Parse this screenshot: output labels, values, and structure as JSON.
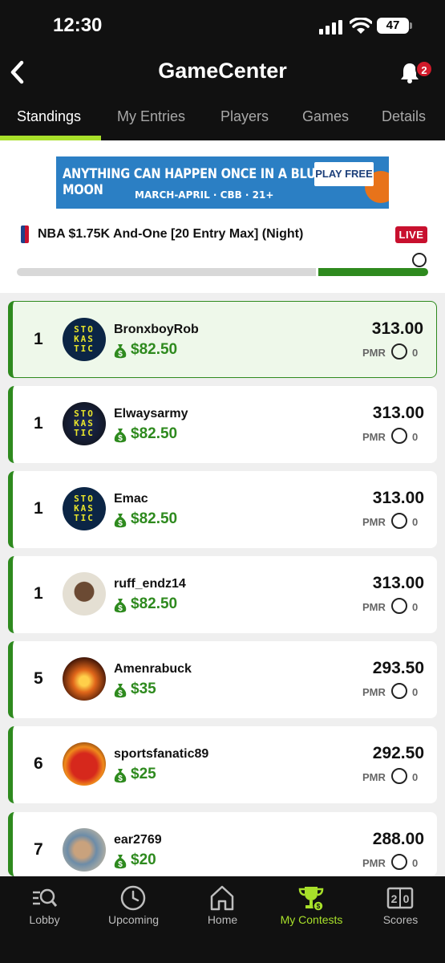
{
  "status_bar": {
    "time": "12:30",
    "battery": "47"
  },
  "header": {
    "title": "GameCenter",
    "notification_count": "2"
  },
  "tabs": [
    {
      "label": "Standings",
      "active": true
    },
    {
      "label": "My Entries",
      "active": false
    },
    {
      "label": "Players",
      "active": false
    },
    {
      "label": "Games",
      "active": false
    },
    {
      "label": "Details",
      "active": false
    }
  ],
  "ad": {
    "headline": "ANYTHING CAN HAPPEN ONCE IN A BLUE MOON",
    "subline": "MARCH-APRIL · CBB · 21+",
    "cta": "PLAY FREE"
  },
  "contest": {
    "name": "NBA $1.75K And-One [20 Entry Max] (Night)",
    "status": "LIVE"
  },
  "standings": [
    {
      "rank": "1",
      "username": "BronxboyRob",
      "winnings": "$82.50",
      "score": "313.00",
      "pmr_label": "PMR",
      "pmr": "0",
      "avatar": "stokastic"
    },
    {
      "rank": "1",
      "username": "Elwaysarmy",
      "winnings": "$82.50",
      "score": "313.00",
      "pmr_label": "PMR",
      "pmr": "0",
      "avatar": "stokastic"
    },
    {
      "rank": "1",
      "username": "Emac",
      "winnings": "$82.50",
      "score": "313.00",
      "pmr_label": "PMR",
      "pmr": "0",
      "avatar": "stokastic"
    },
    {
      "rank": "1",
      "username": "ruff_endz14",
      "winnings": "$82.50",
      "score": "313.00",
      "pmr_label": "PMR",
      "pmr": "0",
      "avatar": "photo"
    },
    {
      "rank": "5",
      "username": "Amenrabuck",
      "winnings": "$35",
      "score": "293.50",
      "pmr_label": "PMR",
      "pmr": "0",
      "avatar": "phoenix"
    },
    {
      "rank": "6",
      "username": "sportsfanatic89",
      "winnings": "$25",
      "score": "292.50",
      "pmr_label": "PMR",
      "pmr": "0",
      "avatar": "elmo"
    },
    {
      "rank": "7",
      "username": "ear2769",
      "winnings": "$20",
      "score": "288.00",
      "pmr_label": "PMR",
      "pmr": "0",
      "avatar": "photo2"
    }
  ],
  "bottom_nav": [
    {
      "label": "Lobby",
      "icon": "lobby-search-icon"
    },
    {
      "label": "Upcoming",
      "icon": "clock-icon"
    },
    {
      "label": "Home",
      "icon": "home-icon"
    },
    {
      "label": "My Contests",
      "icon": "trophy-icon",
      "active": true
    },
    {
      "label": "Scores",
      "icon": "scoreboard-icon"
    }
  ],
  "colors": {
    "accent_green": "#2e8a1e",
    "tab_highlight": "#a8e02a",
    "live_red": "#c8102e"
  }
}
